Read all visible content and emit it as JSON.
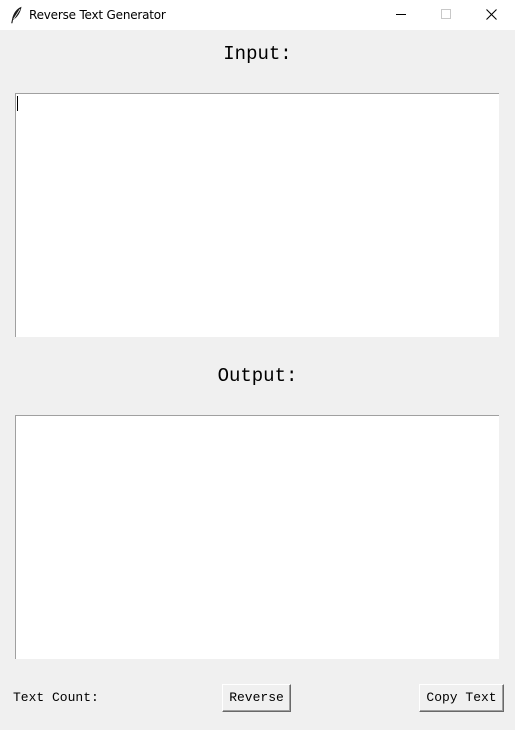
{
  "window": {
    "title": "Reverse Text Generator",
    "icon": "feather-icon",
    "controls": [
      "minimize-icon",
      "maximize-icon",
      "close-icon"
    ]
  },
  "input_section": {
    "heading": "Input:",
    "value": ""
  },
  "output_section": {
    "heading": "Output:",
    "value": ""
  },
  "footer": {
    "count_label": "Text Count:",
    "count_value": "",
    "reverse_label": "Reverse",
    "copy_label": "Copy Text"
  }
}
